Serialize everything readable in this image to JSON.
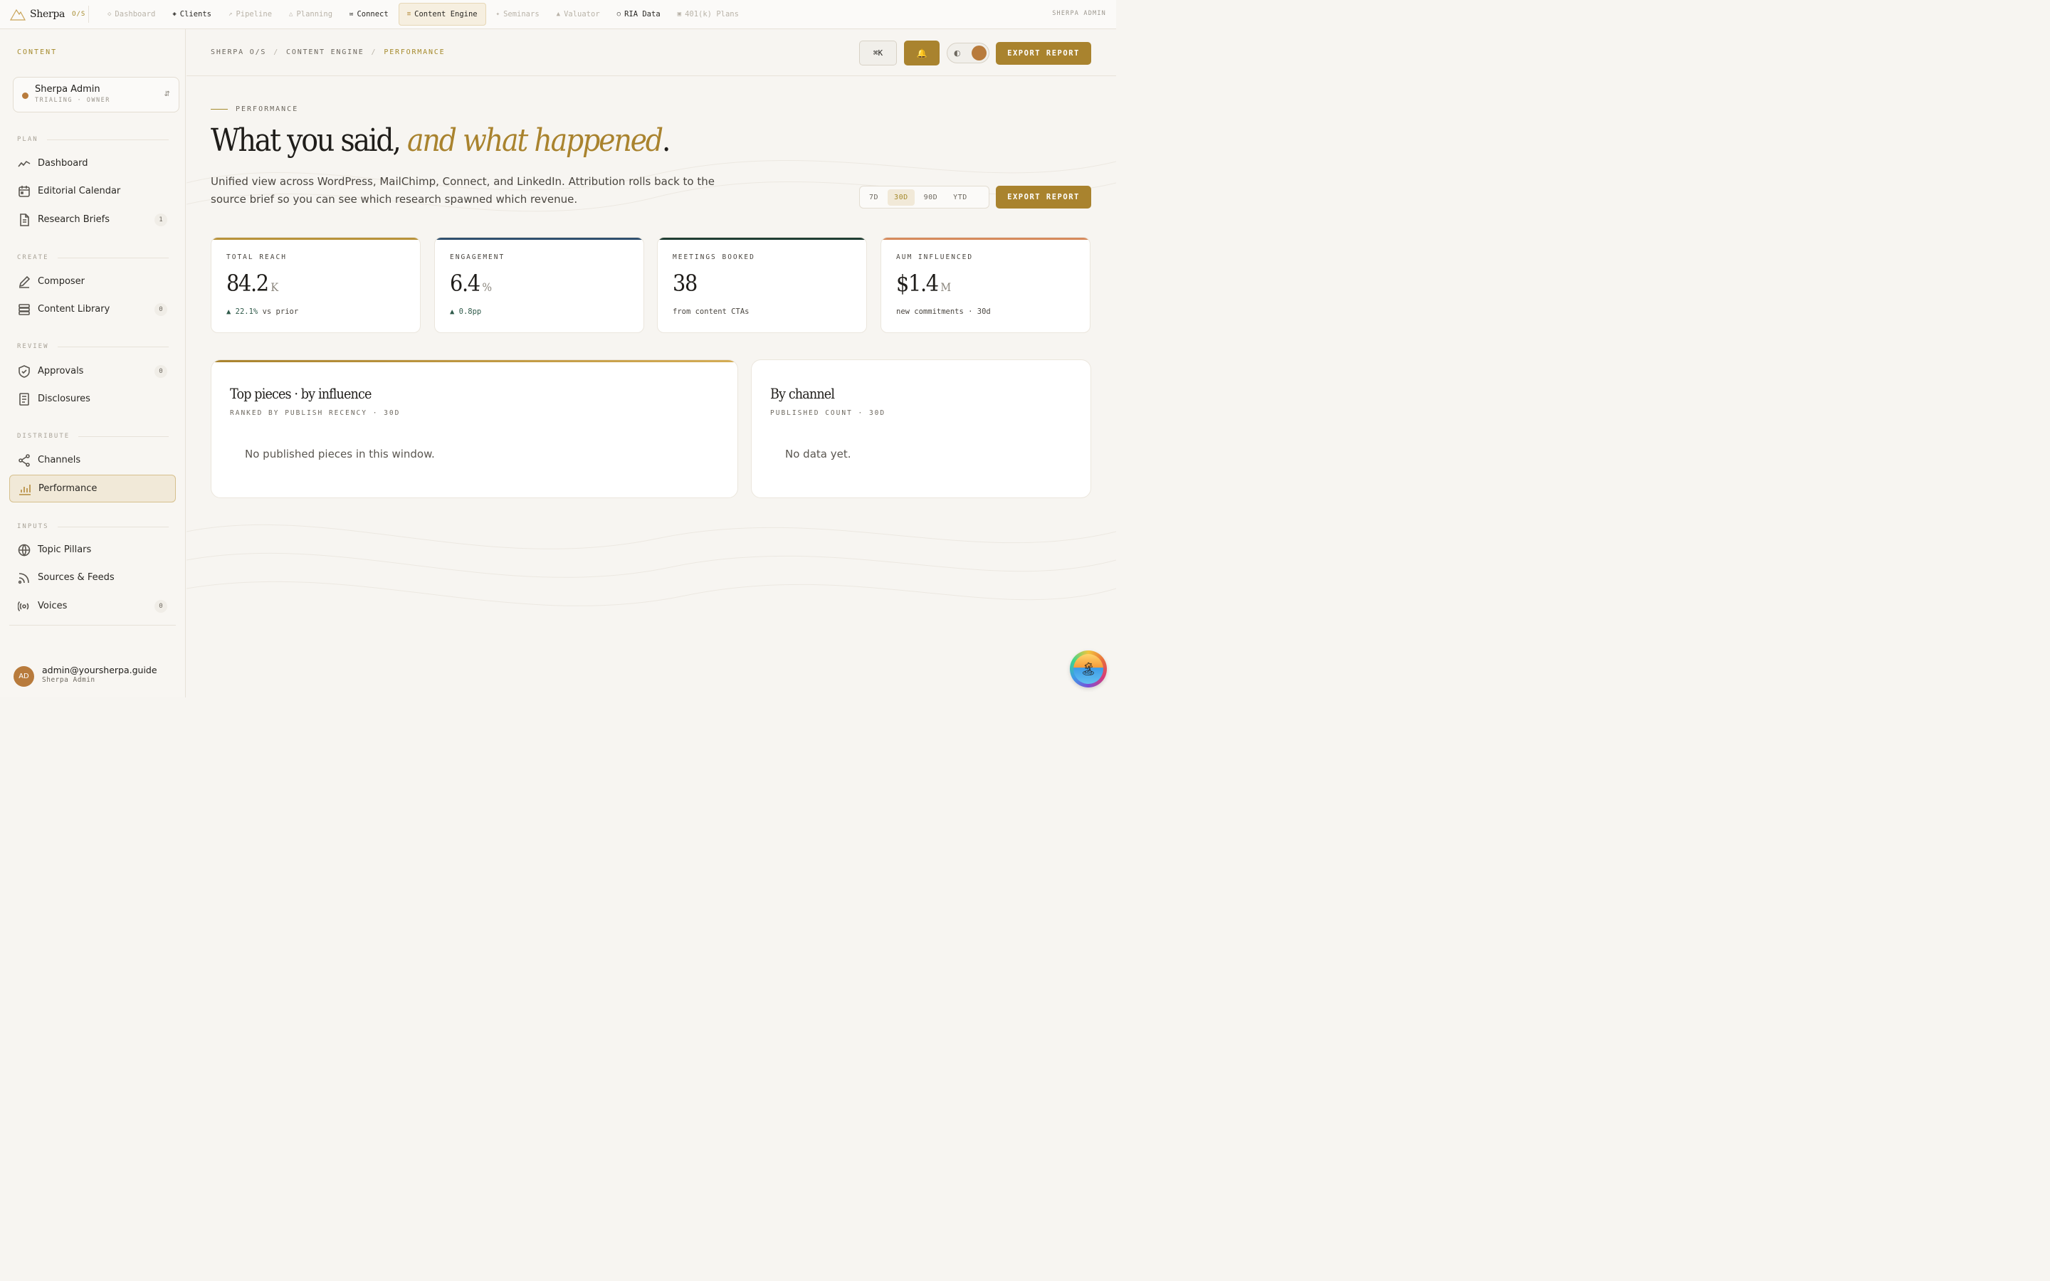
{
  "brand": {
    "name": "Sherpa",
    "tag": "O/S"
  },
  "nav": [
    {
      "label": "Dashboard",
      "icon": "◇",
      "state": "disabled"
    },
    {
      "label": "Clients",
      "icon": "◈",
      "state": "enabled"
    },
    {
      "label": "Pipeline",
      "icon": "↗",
      "state": "disabled"
    },
    {
      "label": "Planning",
      "icon": "△",
      "state": "disabled"
    },
    {
      "label": "Connect",
      "icon": "✉",
      "state": "enabled"
    },
    {
      "label": "Content Engine",
      "icon": "≡",
      "state": "active"
    },
    {
      "label": "Seminars",
      "icon": "✦",
      "state": "disabled"
    },
    {
      "label": "Valuator",
      "icon": "▲",
      "state": "disabled"
    },
    {
      "label": "RIA Data",
      "icon": "○",
      "state": "enabled"
    },
    {
      "label": "401(k) Plans",
      "icon": "▣",
      "state": "disabled"
    }
  ],
  "top_user": "SHERPA ADMIN",
  "sidebar": {
    "heading": "CONTENT",
    "account": {
      "name": "Sherpa Admin",
      "sub": "TRIALING · OWNER",
      "switch_icon": "⇵"
    },
    "sections": {
      "plan": "PLAN",
      "create": "CREATE",
      "review": "REVIEW",
      "distribute": "DISTRIBUTE",
      "inputs": "INPUTS"
    },
    "items": {
      "dashboard": {
        "label": "Dashboard",
        "icon": "trend-icon"
      },
      "calendar": {
        "label": "Editorial Calendar",
        "icon": "calendar-icon"
      },
      "briefs": {
        "label": "Research Briefs",
        "icon": "document-icon",
        "count": "1"
      },
      "composer": {
        "label": "Composer",
        "icon": "pencil-icon"
      },
      "library": {
        "label": "Content Library",
        "icon": "stack-icon",
        "count": "0"
      },
      "approvals": {
        "label": "Approvals",
        "icon": "shield-check-icon",
        "count": "0"
      },
      "disclosures": {
        "label": "Disclosures",
        "icon": "list-doc-icon"
      },
      "channels": {
        "label": "Channels",
        "icon": "share-icon"
      },
      "performance": {
        "label": "Performance",
        "icon": "bar-chart-icon"
      },
      "pillars": {
        "label": "Topic Pillars",
        "icon": "globe-icon"
      },
      "sources": {
        "label": "Sources & Feeds",
        "icon": "rss-icon"
      },
      "voices": {
        "label": "Voices",
        "icon": "broadcast-icon",
        "count": "0"
      }
    },
    "user": {
      "initials": "AD",
      "email": "admin@yoursherpa.guide",
      "role": "Sherpa Admin"
    }
  },
  "header": {
    "crumbs": [
      "SHERPA O/S",
      "CONTENT ENGINE",
      "PERFORMANCE"
    ],
    "search_key": "⌘K",
    "bell_icon": "🔔",
    "theme_icon": "◐",
    "export_label": "EXPORT REPORT"
  },
  "hero": {
    "eyebrow": "PERFORMANCE",
    "title_plain": "What you said, ",
    "title_em": "and what happened",
    "title_end": ".",
    "description": "Unified view across WordPress, MailChimp, Connect, and LinkedIn. Attribution rolls back to the source brief so you can see which research spawned which revenue.",
    "ranges": [
      "7D",
      "30D",
      "90D",
      "YTD"
    ],
    "active_range": "30D",
    "export_label": "EXPORT REPORT"
  },
  "stats": [
    {
      "label": "TOTAL REACH",
      "value": "84.2",
      "unit": "K",
      "delta": "▲ 22.1%",
      "foot": " vs prior",
      "accent": "#b8923a"
    },
    {
      "label": "ENGAGEMENT",
      "value": "6.4",
      "unit": "%",
      "delta": "▲ 0.8pp",
      "foot": "",
      "accent": "#2f4f6e"
    },
    {
      "label": "MEETINGS BOOKED",
      "value": "38",
      "unit": "",
      "delta": "",
      "foot": "from content CTAs",
      "accent": "#1f3d33"
    },
    {
      "label": "AUM INFLUENCED",
      "value": "$1.4",
      "unit": "M",
      "delta": "",
      "foot": "new commitments · 30d",
      "accent": "#d68a5c"
    }
  ],
  "panels": {
    "top": {
      "title": "Top pieces · by influence",
      "sub": "RANKED BY PUBLISH RECENCY · 30D",
      "empty": "No published pieces in this window."
    },
    "channel": {
      "title": "By channel",
      "sub": "PUBLISHED COUNT · 30D",
      "empty": "No data yet."
    }
  },
  "fab_icon": "🏝"
}
